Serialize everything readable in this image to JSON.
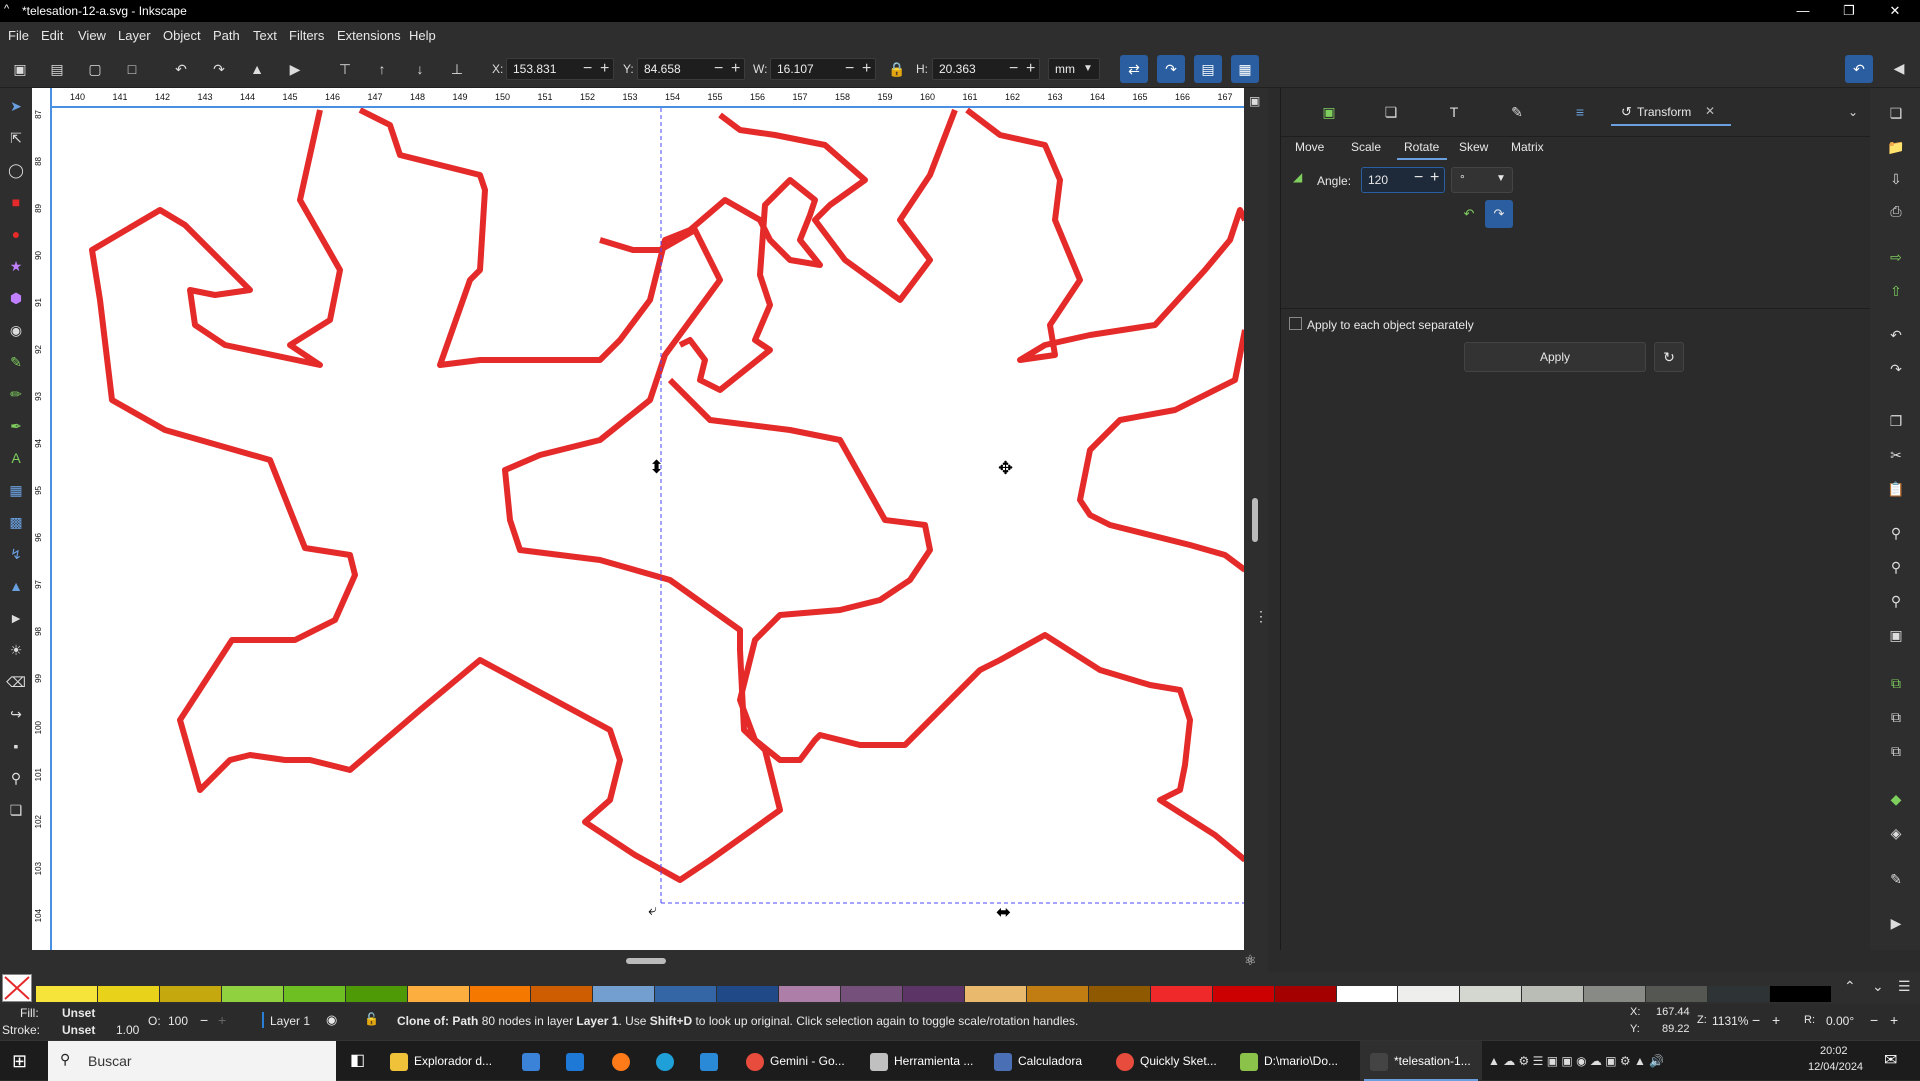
{
  "window": {
    "title": "*telesation-12-a.svg - Inkscape"
  },
  "menu": [
    "File",
    "Edit",
    "View",
    "Layer",
    "Object",
    "Path",
    "Text",
    "Filters",
    "Extensions",
    "Help"
  ],
  "toolbar": {
    "x_label": "X:",
    "x_value": "153.831",
    "y_label": "Y:",
    "y_value": "84.658",
    "w_label": "W:",
    "w_value": "16.107",
    "h_label": "H:",
    "h_value": "20.363",
    "unit": "mm"
  },
  "ruler_h": [
    "140",
    "141",
    "142",
    "143",
    "144",
    "145",
    "146",
    "147",
    "148",
    "149",
    "150",
    "151",
    "152",
    "153",
    "154",
    "155",
    "156",
    "157",
    "158",
    "159",
    "160",
    "161",
    "162",
    "163",
    "164",
    "165",
    "166",
    "167"
  ],
  "ruler_v": [
    "87",
    "88",
    "89",
    "90",
    "91",
    "92",
    "93",
    "94",
    "95",
    "96",
    "97",
    "98",
    "99",
    "100",
    "101",
    "102",
    "103",
    "104"
  ],
  "panel": {
    "active_tab": "Transform",
    "tabs": [
      "Move",
      "Scale",
      "Rotate",
      "Skew",
      "Matrix"
    ],
    "selected_subtab": "Rotate",
    "angle_label": "Angle:",
    "angle_value": "120",
    "angle_unit": "°",
    "apply_each_label": "Apply to each object separately",
    "apply_label": "Apply"
  },
  "palette": [
    "#f6e43a",
    "#e8d21a",
    "#c4a80e",
    "#8fd13f",
    "#6ebf22",
    "#4e9a06",
    "#fcaf3e",
    "#f57900",
    "#ce5c00",
    "#729fcf",
    "#3465a4",
    "#204a87",
    "#ad7fa8",
    "#75507b",
    "#5c3566",
    "#e9b96e",
    "#c17d11",
    "#8f5902",
    "#ef2929",
    "#cc0000",
    "#a40000",
    "#ffffff",
    "#eeeeec",
    "#d3d7cf",
    "#babdb6",
    "#888a85",
    "#555753",
    "#2e3436",
    "#000000"
  ],
  "status": {
    "fill_label": "Fill:",
    "fill_value": "Unset",
    "stroke_label": "Stroke:",
    "stroke_value": "Unset",
    "stroke_width": "1.00",
    "opacity_label": "O:",
    "opacity_value": "100",
    "layer": "Layer 1",
    "message_bold1": "Clone of:",
    "message_bold2": "Path",
    "message_rest1": " 80 nodes in layer ",
    "message_layer": "Layer 1",
    "message_rest2": ". Use ",
    "message_key": "Shift+D",
    "message_rest3": " to look up original. Click selection again to toggle scale/rotation handles.",
    "x_coord_label": "X:",
    "x_coord": "167.44",
    "y_coord_label": "Y:",
    "y_coord": "89.22",
    "zoom_label": "Z:",
    "zoom": "1131%",
    "rotation_label": "R:",
    "rotation": "0.00°"
  },
  "taskbar": {
    "search_placeholder": "Buscar",
    "apps": [
      "Explorador d...",
      "Gemini - Go...",
      "Herramienta ...",
      "Calculadora",
      "Quickly Sket...",
      "D:\\mario\\Do...",
      "*telesation-1..."
    ],
    "time": "20:02",
    "date": "12/04/2024"
  },
  "colors": {
    "accent": "#2a5ea0",
    "stroke": "#e52a2a"
  }
}
